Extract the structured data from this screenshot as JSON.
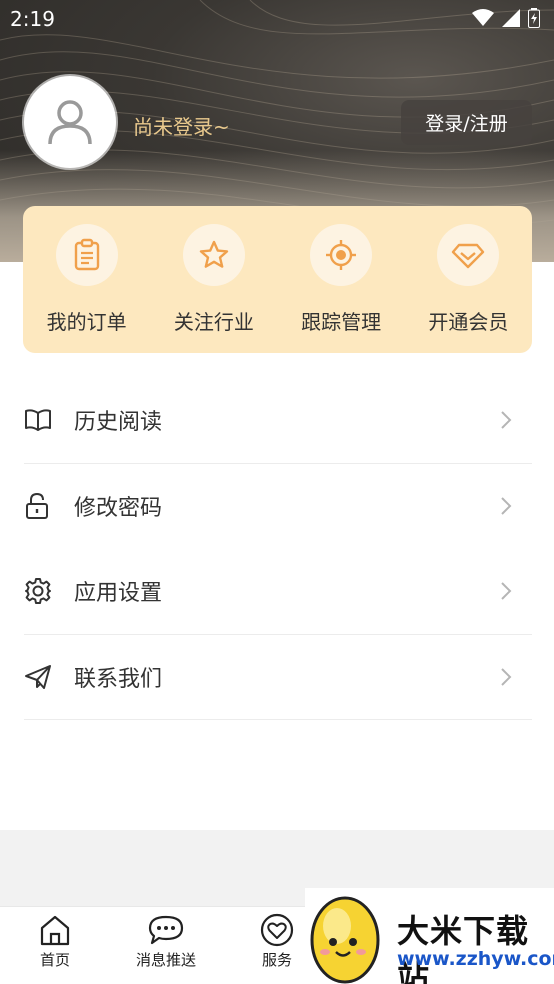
{
  "status_bar": {
    "time": "2:19"
  },
  "profile": {
    "login_status": "尚未登录~",
    "login_button": "登录/注册"
  },
  "quick_actions": [
    {
      "label": "我的订单",
      "icon": "clipboard-icon"
    },
    {
      "label": "关注行业",
      "icon": "star-icon"
    },
    {
      "label": "跟踪管理",
      "icon": "target-icon"
    },
    {
      "label": "开通会员",
      "icon": "diamond-icon"
    }
  ],
  "menu": [
    {
      "label": "历史阅读",
      "icon": "book-icon"
    },
    {
      "label": "修改密码",
      "icon": "lock-icon"
    },
    {
      "label": "应用设置",
      "icon": "gear-icon"
    },
    {
      "label": "联系我们",
      "icon": "send-icon"
    }
  ],
  "tabbar": [
    {
      "label": "首页",
      "icon": "home-icon"
    },
    {
      "label": "消息推送",
      "icon": "message-icon"
    },
    {
      "label": "服务",
      "icon": "heart-icon"
    }
  ],
  "watermark": {
    "brand": "大米下载站",
    "url": "www.zzhyw.com"
  },
  "colors": {
    "accent": "#f0a04b",
    "card": "#fde8bf",
    "login_text": "#e9c98d"
  }
}
